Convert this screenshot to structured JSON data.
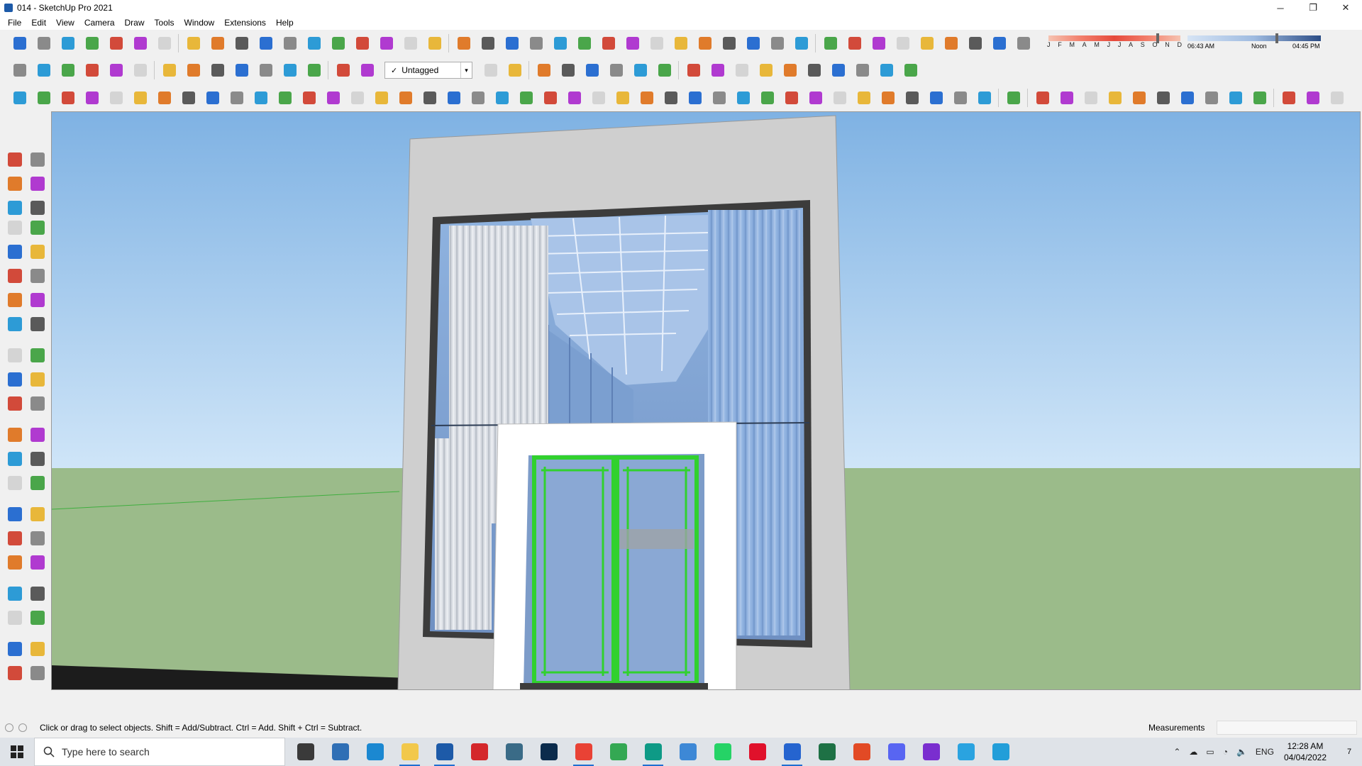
{
  "window": {
    "title": "014 - SketchUp Pro 2021",
    "controls": {
      "minimize": "─",
      "restore": "❐",
      "close": "✕"
    }
  },
  "menu": [
    "File",
    "Edit",
    "View",
    "Camera",
    "Draw",
    "Tools",
    "Window",
    "Extensions",
    "Help"
  ],
  "tag_select": {
    "value": "Untagged",
    "check": "✓",
    "arrow": "▾"
  },
  "shadow": {
    "months": [
      "J",
      "F",
      "M",
      "A",
      "M",
      "J",
      "J",
      "A",
      "S",
      "O",
      "N",
      "D"
    ],
    "time_start": "06:43 AM",
    "time_mid": "Noon",
    "time_end": "04:45 PM"
  },
  "status": {
    "hint": "Click or drag to select objects. Shift = Add/Subtract. Ctrl = Add. Shift + Ctrl = Subtract.",
    "measurements_label": "Measurements"
  },
  "taskbar": {
    "search_placeholder": "Type here to search",
    "language": "ENG",
    "time": "12:28 AM",
    "date": "04/04/2022",
    "notification_count": "7",
    "apps": [
      {
        "name": "task-view",
        "color": "#3a3a3a"
      },
      {
        "name": "calculator",
        "color": "#2f6fb5"
      },
      {
        "name": "edge",
        "color": "#1b88d1"
      },
      {
        "name": "file-explorer",
        "color": "#f2c84b"
      },
      {
        "name": "sketchup",
        "color": "#1d5aa8"
      },
      {
        "name": "acrobat",
        "color": "#d4272b"
      },
      {
        "name": "autocad",
        "color": "#3a6b87"
      },
      {
        "name": "photoshop",
        "color": "#0b2b4c"
      },
      {
        "name": "chrome",
        "color": "#e94235"
      },
      {
        "name": "chrome-2",
        "color": "#34a853"
      },
      {
        "name": "app-green",
        "color": "#0e9a86"
      },
      {
        "name": "app-blue",
        "color": "#3d88d6"
      },
      {
        "name": "whatsapp",
        "color": "#25d366"
      },
      {
        "name": "opera",
        "color": "#e0112b"
      },
      {
        "name": "todo",
        "color": "#2564cf"
      },
      {
        "name": "excel",
        "color": "#1e7145"
      },
      {
        "name": "grammarly",
        "color": "#e24a25"
      },
      {
        "name": "discord",
        "color": "#5865f2"
      },
      {
        "name": "app-purple",
        "color": "#7a2ecf"
      },
      {
        "name": "telegram",
        "color": "#2aa3e0"
      },
      {
        "name": "telegram-2",
        "color": "#229ed9"
      }
    ]
  }
}
